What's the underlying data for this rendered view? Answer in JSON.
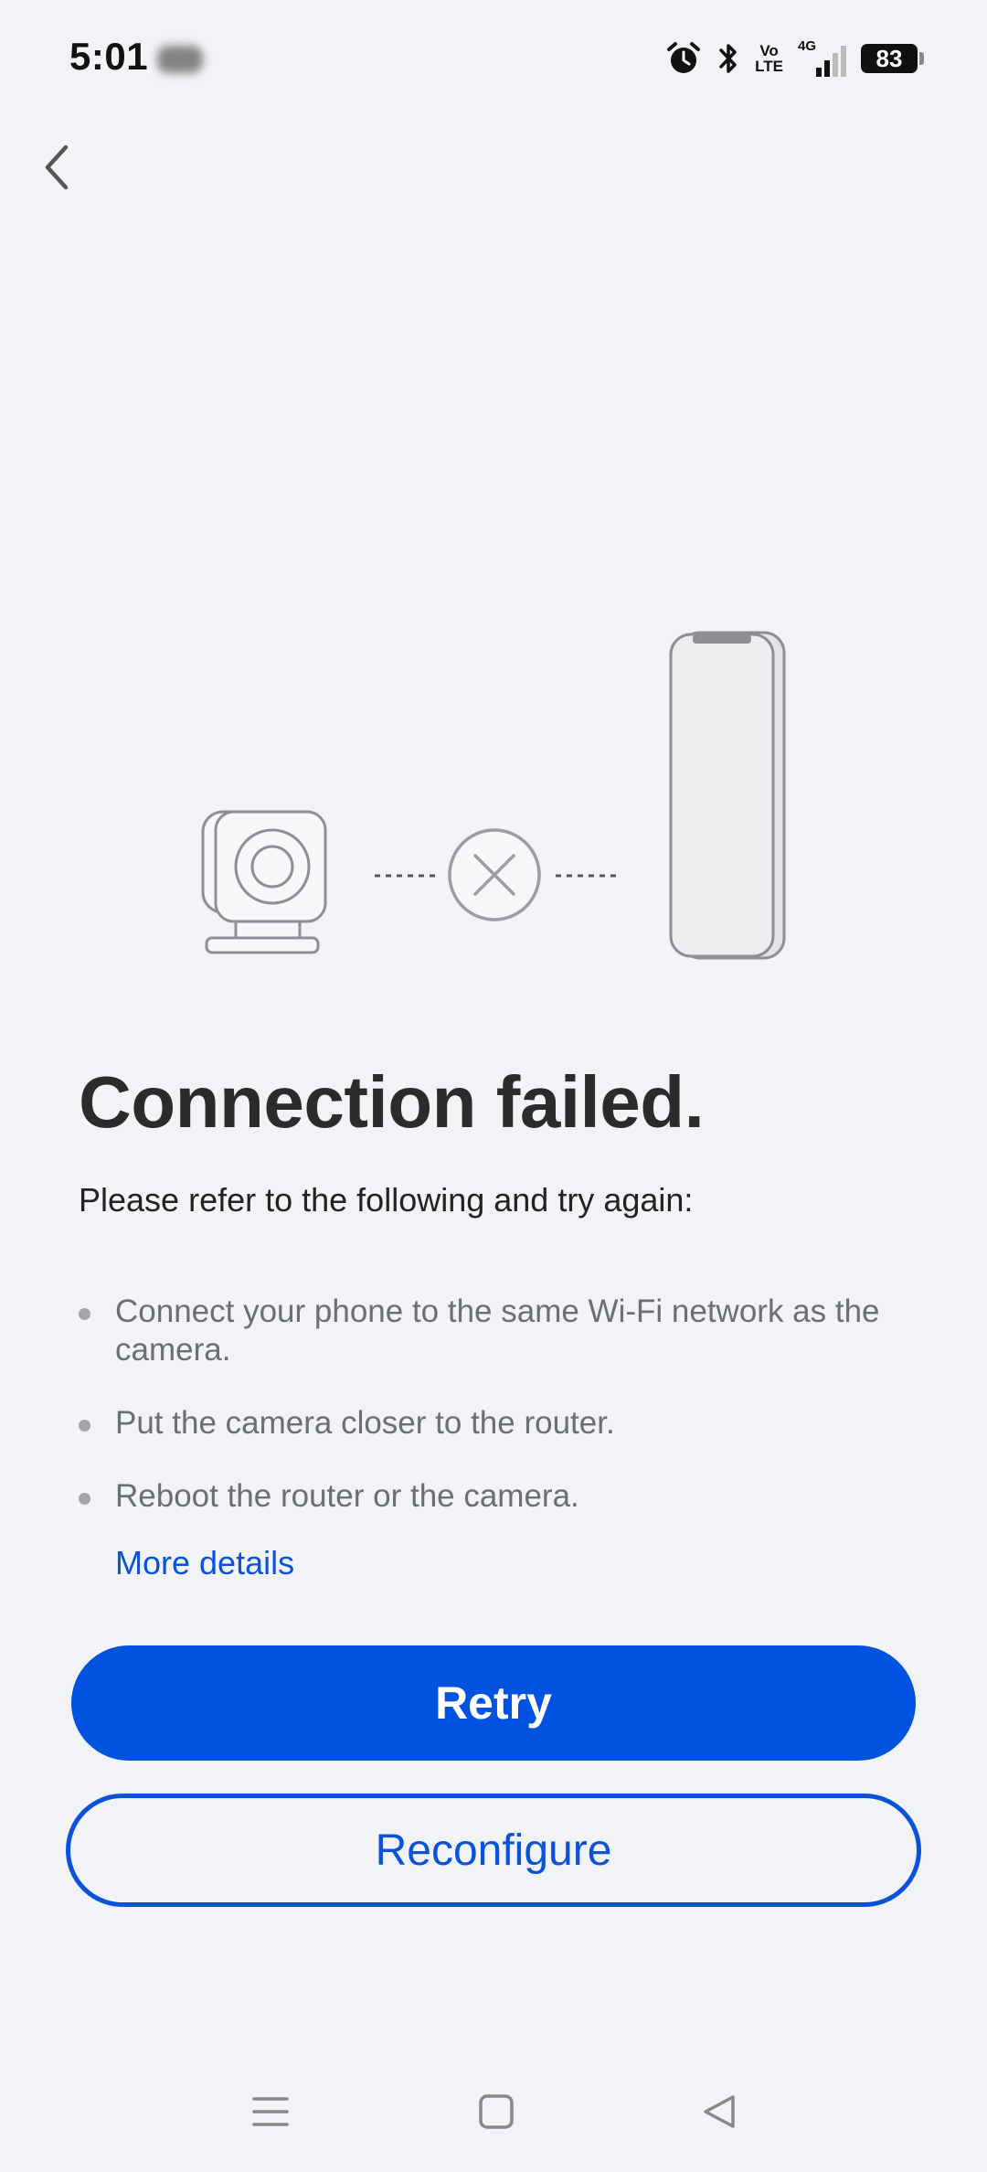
{
  "status_bar": {
    "time": "5:01",
    "network_label_top": "Vo",
    "network_label_bottom": "LTE",
    "data_type": "4G",
    "battery": "83"
  },
  "header": {
    "back_icon": "chevron-left-icon"
  },
  "illustration": {
    "camera_icon": "camera-icon",
    "status_icon": "x-circle-icon",
    "phone_icon": "phone-icon"
  },
  "main": {
    "title": "Connection failed.",
    "subtitle": "Please refer to the following and try again:",
    "tips": [
      "Connect your phone to the same Wi-Fi network as the camera.",
      "Put the camera closer to the router.",
      "Reboot the router or the camera."
    ],
    "more_details": "More details"
  },
  "actions": {
    "retry_label": "Retry",
    "reconfigure_label": "Reconfigure"
  },
  "nav_bar": {
    "menu_icon": "menu-icon",
    "home_icon": "home-icon",
    "back_icon": "back-triangle-icon"
  },
  "colors": {
    "background": "#f2f3f6",
    "accent": "#0052e0",
    "link": "#0a52d9",
    "tip_text": "#6c6e76"
  }
}
